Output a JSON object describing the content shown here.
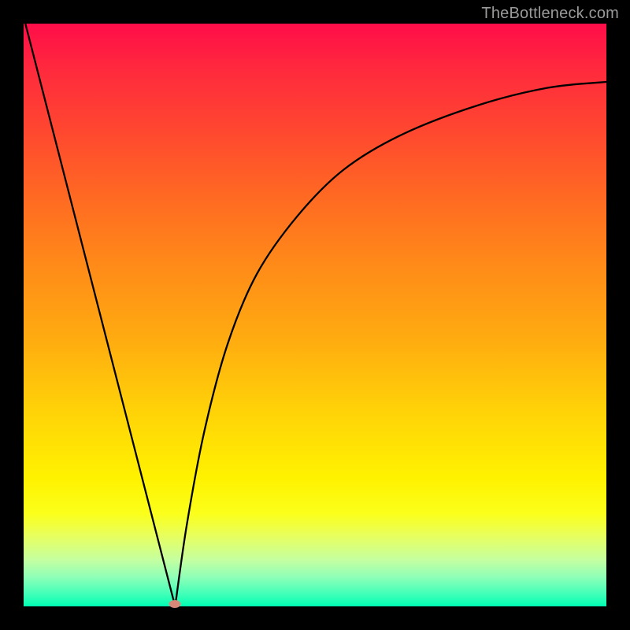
{
  "watermark": "TheBottleneck.com",
  "colors": {
    "frame_bg": "#000000",
    "curve_stroke": "#000000",
    "min_marker": "#d88878"
  },
  "chart_data": {
    "type": "line",
    "title": "",
    "xlabel": "",
    "ylabel": "",
    "x_range": [
      0,
      100
    ],
    "y_range": [
      0,
      100
    ],
    "minimum": {
      "x": 26,
      "y": 0
    },
    "left_branch": {
      "description": "steep linear descent from top-left to minimum",
      "points": [
        {
          "x": 0.3,
          "y": 100
        },
        {
          "x": 26,
          "y": 0
        }
      ]
    },
    "right_branch": {
      "description": "rising curve from minimum asymptotically approaching ~90 at right edge",
      "points": [
        {
          "x": 26,
          "y": 0
        },
        {
          "x": 28,
          "y": 14
        },
        {
          "x": 31,
          "y": 30
        },
        {
          "x": 35,
          "y": 45
        },
        {
          "x": 40,
          "y": 57
        },
        {
          "x": 47,
          "y": 67
        },
        {
          "x": 55,
          "y": 75
        },
        {
          "x": 65,
          "y": 81
        },
        {
          "x": 78,
          "y": 86
        },
        {
          "x": 90,
          "y": 89
        },
        {
          "x": 100,
          "y": 90
        }
      ]
    }
  }
}
